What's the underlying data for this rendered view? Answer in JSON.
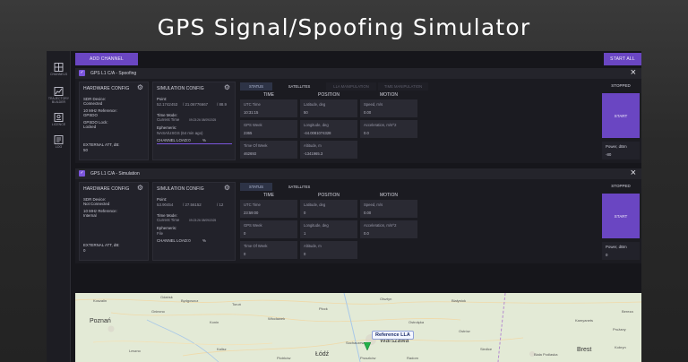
{
  "page": {
    "title": "GPS Signal/Spoofing Simulator"
  },
  "colors": {
    "accent": "#6a46c2",
    "panel": "#22222a",
    "background": "#16161b"
  },
  "sidebar": {
    "items": [
      {
        "label": "CHANNELS",
        "icon": "channels-grid-icon"
      },
      {
        "label": "TRAJECTORY BUILDER",
        "icon": "trajectory-icon"
      },
      {
        "label": "LICENCE",
        "icon": "licence-icon"
      },
      {
        "label": "LOG",
        "icon": "log-icon"
      }
    ]
  },
  "toolbar": {
    "add_channel": "ADD CHANNEL",
    "start_all": "START ALL"
  },
  "channels": [
    {
      "title": "GPS L1 C/A - Spoofing",
      "hardware": {
        "title": "HARDWARE CONFIG",
        "sdr_label": "SDR Device:",
        "sdr_value": "Connected",
        "ref_label": "10 MHz Reference:",
        "ref_value": "GPSDO",
        "lock_label": "GPSDO Lock:",
        "lock_value": "Locked",
        "att_label": "EXTERNAL ATT, dB:",
        "att_value": "50"
      },
      "simulation": {
        "title": "SIMULATION CONFIG",
        "point_label": "Point:",
        "point_lat": "52.1742453",
        "point_lon": "/ 21.06776667",
        "point_alt": "/ 88.9",
        "time_mode_label": "Time Mode:",
        "time_mode_value": "Current Time",
        "time_mode_stamp": "09:23:26 08/09/2025",
        "ephemeris_label": "Ephemeris:",
        "ephemeris_value": "NASA/USGS (64 min ago)",
        "channel_load_label": "CHANNEL LOAD:0",
        "channel_load_unit": "%"
      },
      "tabs": [
        "STATUS",
        "SATELLITES",
        "LLA MANIPULATION",
        "TIME MANIPULATION"
      ],
      "columns": [
        "TIME",
        "POSITION",
        "MOTION"
      ],
      "cells": [
        {
          "label": "UTC Time",
          "value": "10:31:15"
        },
        {
          "label": "Latitude, deg",
          "value": "50"
        },
        {
          "label": "Speed, m/s",
          "value": "0.00"
        },
        {
          "label": "GPS Week",
          "value": "2365"
        },
        {
          "label": "Longitude, deg",
          "value": "-44.0081074328"
        },
        {
          "label": "Acceleration, m/s^2",
          "value": "0.0"
        },
        {
          "label": "Time Of Week",
          "value": "462693"
        },
        {
          "label": "Altitude, m",
          "value": "-1341965.3"
        }
      ],
      "status": {
        "label": "STOPPED",
        "start": "START",
        "power_label": "Power, dBm",
        "power_value": "-80"
      }
    },
    {
      "title": "GPS L1 C/A - Simulation",
      "hardware": {
        "title": "HARDWARE CONFIG",
        "sdr_label": "SDR Device:",
        "sdr_value": "Not Connected",
        "ref_label": "10 MHz Reference:",
        "ref_value": "Internal",
        "att_label": "EXTERNAL ATT, dB:",
        "att_value": "0"
      },
      "simulation": {
        "title": "SIMULATION CONFIG",
        "point_label": "Point:",
        "point_lat": "53.90454",
        "point_lon": "/ 27.56152",
        "point_alt": "/ 12",
        "time_mode_label": "Time Mode:",
        "time_mode_value": "Current Time",
        "time_mode_stamp": "09:23:26 08/09/2025",
        "ephemeris_label": "Ephemeris:",
        "ephemeris_value": "File",
        "channel_load_label": "CHANNEL LOAD:0",
        "channel_load_unit": "%"
      },
      "tabs": [
        "STATUS",
        "SATELLITES"
      ],
      "columns": [
        "TIME",
        "POSITION",
        "MOTION"
      ],
      "cells": [
        {
          "label": "UTC Time",
          "value": "23:59:00"
        },
        {
          "label": "Latitude, deg",
          "value": "0"
        },
        {
          "label": "Speed, m/s",
          "value": "0.00"
        },
        {
          "label": "GPS Week",
          "value": "0"
        },
        {
          "label": "Longitude, deg",
          "value": "1"
        },
        {
          "label": "Acceleration, m/s^2",
          "value": "0.0"
        },
        {
          "label": "Time Of Week",
          "value": "0"
        },
        {
          "label": "Altitude, m",
          "value": "0"
        }
      ],
      "status": {
        "label": "STOPPED",
        "start": "START",
        "power_label": "Power, dBm",
        "power_value": "0"
      }
    }
  ],
  "map": {
    "reference_label": "Reference LLA",
    "cities": [
      {
        "name": "Gdańsk"
      },
      {
        "name": "Koszalin"
      },
      {
        "name": "Toruń"
      },
      {
        "name": "Poznań"
      },
      {
        "name": "Bydgoszcz"
      },
      {
        "name": "Olsztyn"
      },
      {
        "name": "Białystok"
      },
      {
        "name": "Warszawa"
      },
      {
        "name": "Płock"
      },
      {
        "name": "Łódź"
      },
      {
        "name": "Radom"
      },
      {
        "name": "Siedlce"
      },
      {
        "name": "Ostrołęka"
      },
      {
        "name": "Brest"
      },
      {
        "name": "Kamyanets"
      },
      {
        "name": "Pružany"
      },
      {
        "name": "Bereza"
      },
      {
        "name": "Kobryn"
      },
      {
        "name": "Konin"
      },
      {
        "name": "Kalisz"
      },
      {
        "name": "Włocławek"
      },
      {
        "name": "Sochaczew"
      },
      {
        "name": "Piotrków"
      },
      {
        "name": "Pruszków"
      },
      {
        "name": "Biała Podlaska"
      },
      {
        "name": "Ostrów"
      },
      {
        "name": "Leszno"
      },
      {
        "name": "Gniezno"
      }
    ]
  }
}
